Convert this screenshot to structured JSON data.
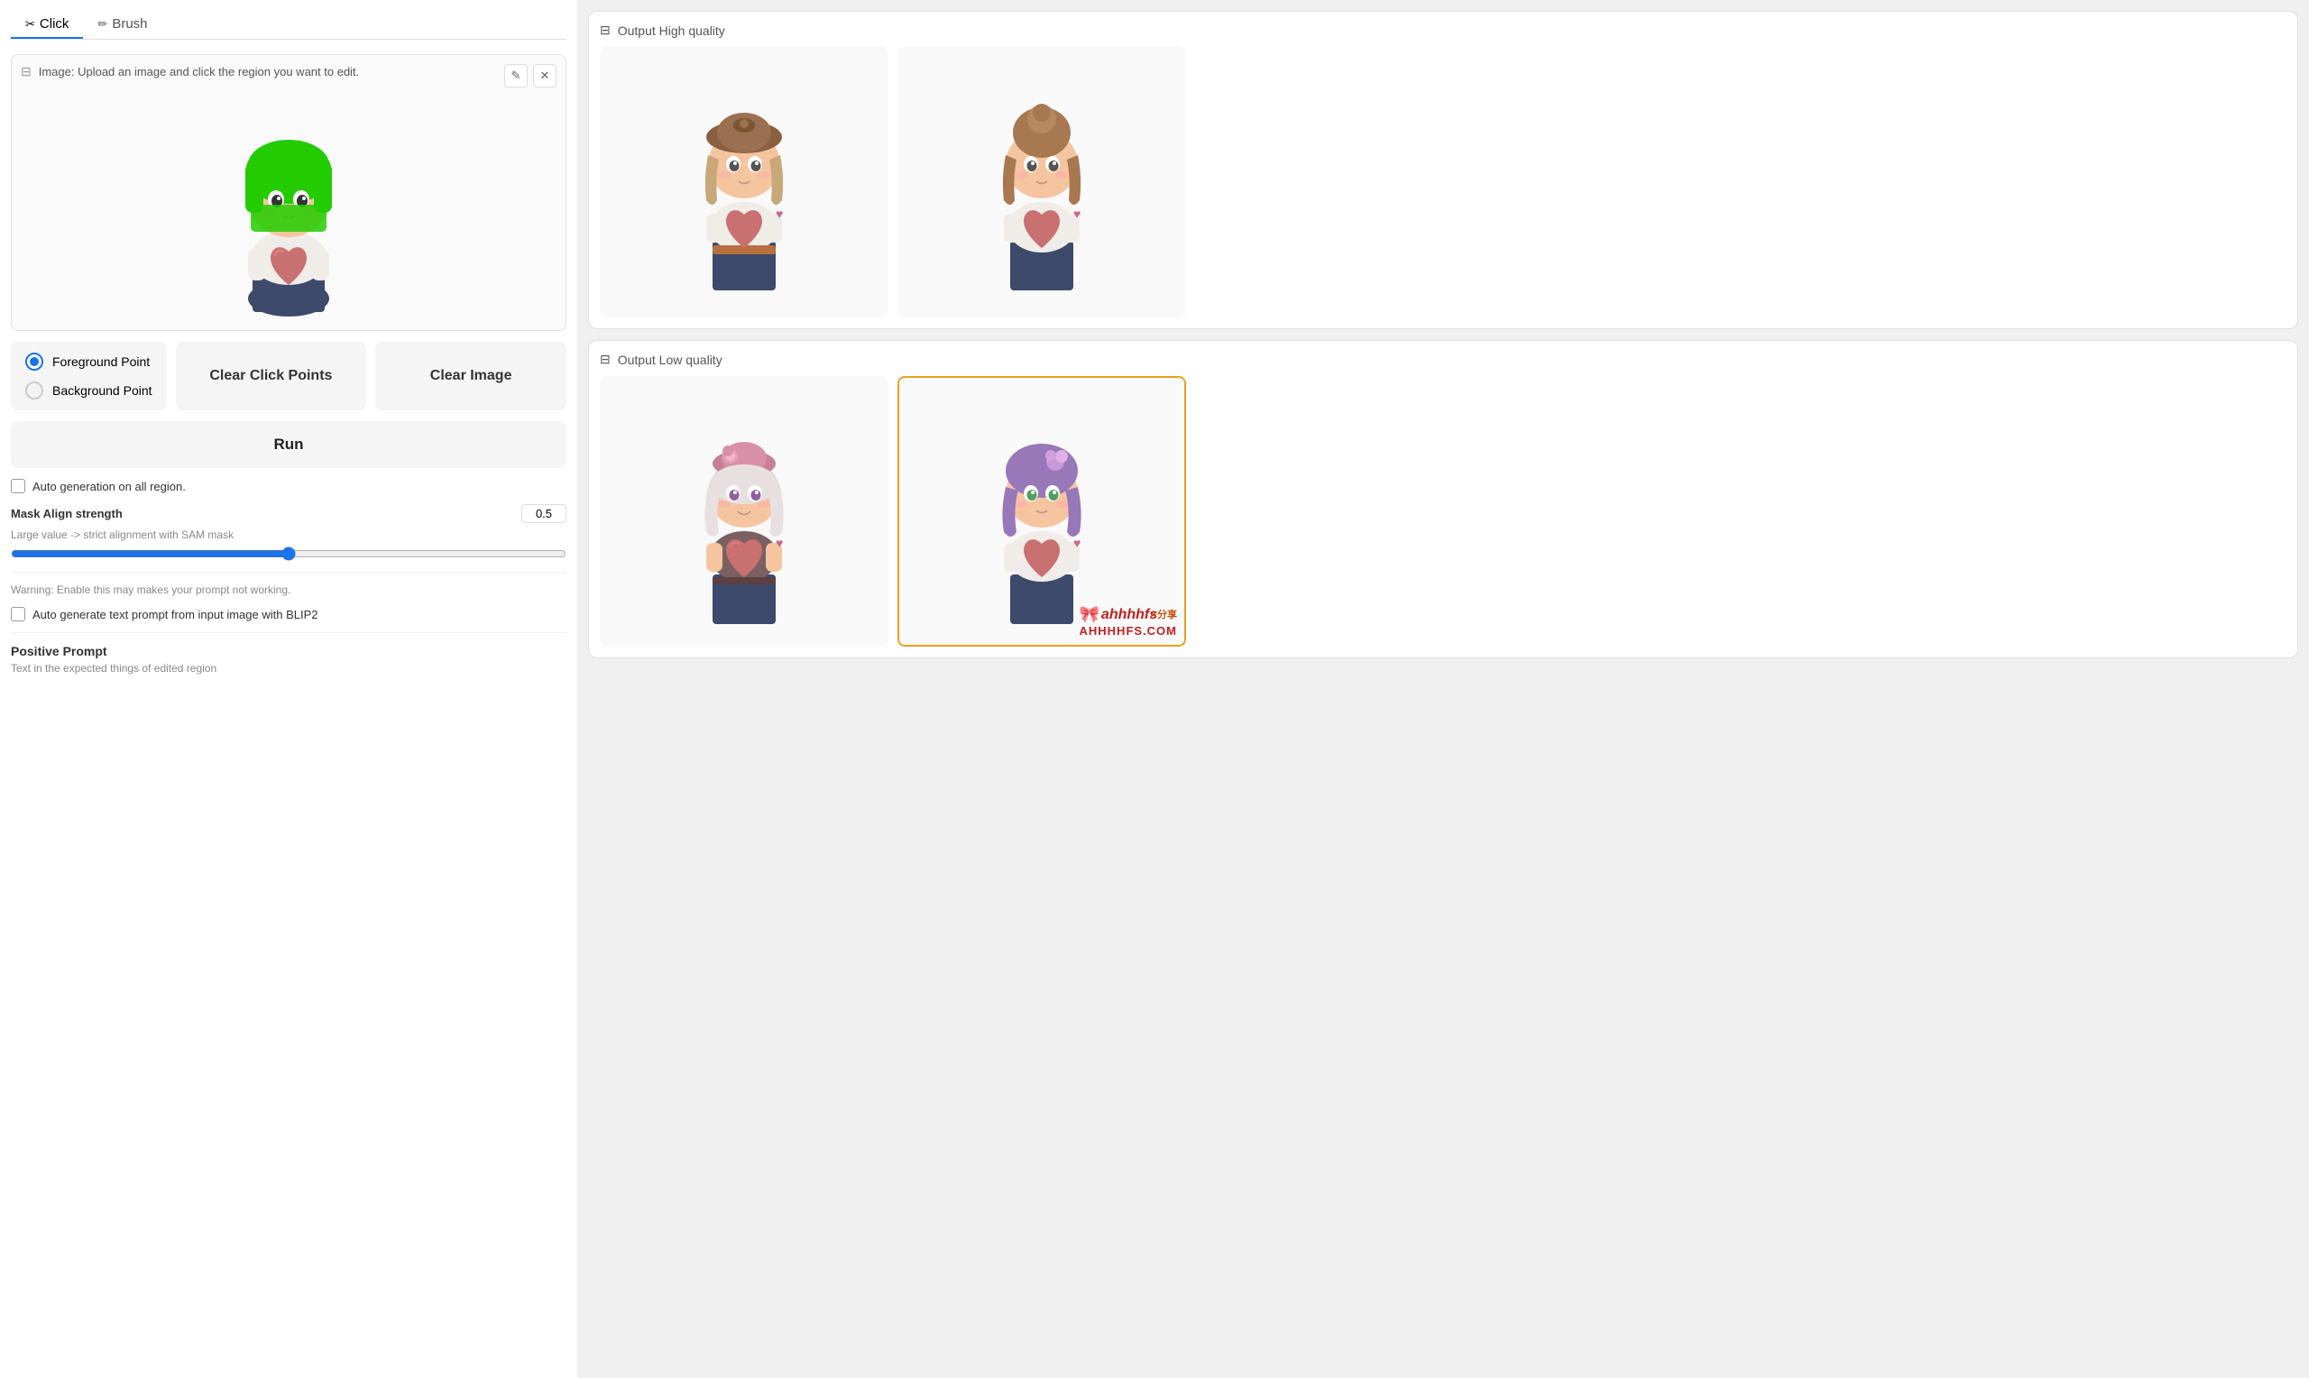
{
  "tabs": [
    {
      "id": "click",
      "label": "Click",
      "icon": "✂",
      "active": true
    },
    {
      "id": "brush",
      "label": "Brush",
      "icon": "✏",
      "active": false
    }
  ],
  "imageArea": {
    "headerText": "Image: Upload an image and click the region you want to edit.",
    "editIcon": "✎",
    "closeIcon": "✕"
  },
  "pointSelector": {
    "foregroundLabel": "Foreground Point",
    "backgroundLabel": "Background Point",
    "selectedOption": "foreground"
  },
  "buttons": {
    "clearClickPoints": "Clear Click Points",
    "clearImage": "Clear Image",
    "run": "Run"
  },
  "autoGeneration": {
    "label": "Auto generation on all region.",
    "checked": false
  },
  "maskAlign": {
    "label": "Mask Align strength",
    "hint": "Large value -> strict alignment with SAM mask",
    "value": "0.5",
    "sliderPercent": 50
  },
  "warning": {
    "text": "Warning: Enable this may makes your prompt not working."
  },
  "blip2": {
    "label": "Auto generate text prompt from input image with BLIP2",
    "checked": false
  },
  "positivePrompt": {
    "label": "Positive Prompt",
    "hint": "Text in the expected things of edited region"
  },
  "outputHighQuality": {
    "title": "Output High quality",
    "images": [
      {
        "id": "hq1",
        "selected": false,
        "character": "brown_hat_girl"
      },
      {
        "id": "hq2",
        "selected": false,
        "character": "brown_bun_girl"
      }
    ]
  },
  "outputLowQuality": {
    "title": "Output Low quality",
    "images": [
      {
        "id": "lq1",
        "selected": false,
        "character": "pink_hat_girl"
      },
      {
        "id": "lq2",
        "selected": true,
        "character": "purple_hair_girl"
      }
    ]
  },
  "watermark": "ahhhhfs\nAHHHHFS.COM"
}
